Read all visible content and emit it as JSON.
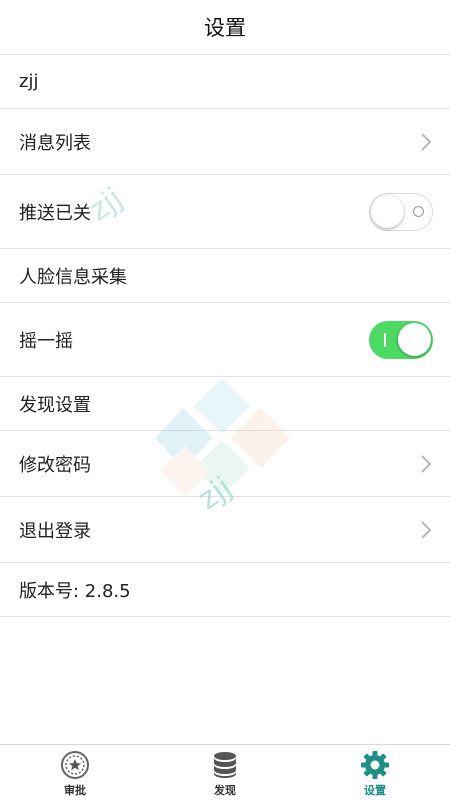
{
  "header": {
    "title": "设置"
  },
  "rows": {
    "user": "zjj",
    "messages": "消息列表",
    "push": "推送已关",
    "face": "人脸信息采集",
    "shake": "摇一摇",
    "discover_settings": "发现设置",
    "change_password": "修改密码",
    "logout": "退出登录",
    "version": "版本号: 2.8.5"
  },
  "toggles": {
    "push_enabled": false,
    "shake_enabled": true
  },
  "watermark": {
    "text": "zjj"
  },
  "tabs": [
    {
      "label": "审批",
      "icon": "badge-icon",
      "active": false
    },
    {
      "label": "发现",
      "icon": "database-icon",
      "active": false
    },
    {
      "label": "设置",
      "icon": "gear-icon",
      "active": true
    }
  ],
  "colors": {
    "accent": "#1d8f86",
    "toggle_on": "#4cd964"
  }
}
